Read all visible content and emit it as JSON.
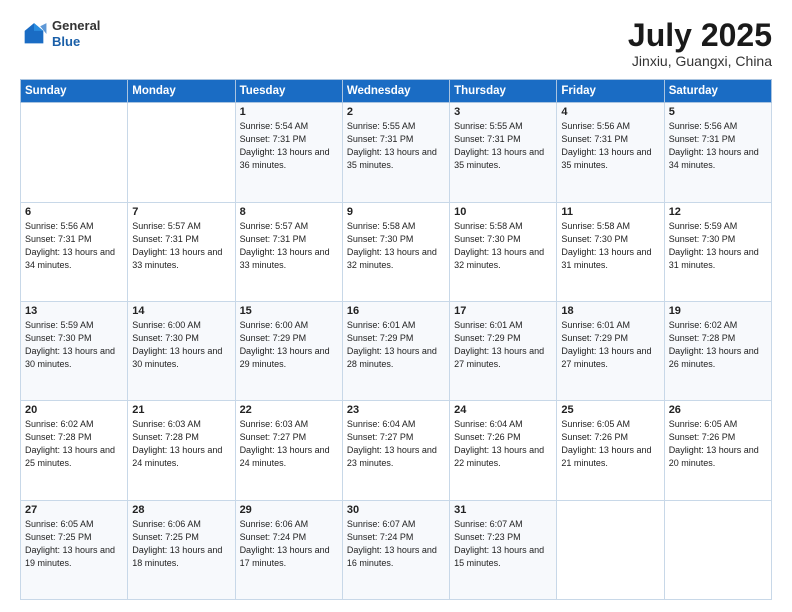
{
  "header": {
    "logo_general": "General",
    "logo_blue": "Blue",
    "month_title": "July 2025",
    "location": "Jinxiu, Guangxi, China"
  },
  "weekdays": [
    "Sunday",
    "Monday",
    "Tuesday",
    "Wednesday",
    "Thursday",
    "Friday",
    "Saturday"
  ],
  "weeks": [
    [
      {
        "day": "",
        "info": ""
      },
      {
        "day": "",
        "info": ""
      },
      {
        "day": "1",
        "info": "Sunrise: 5:54 AM\nSunset: 7:31 PM\nDaylight: 13 hours and 36 minutes."
      },
      {
        "day": "2",
        "info": "Sunrise: 5:55 AM\nSunset: 7:31 PM\nDaylight: 13 hours and 35 minutes."
      },
      {
        "day": "3",
        "info": "Sunrise: 5:55 AM\nSunset: 7:31 PM\nDaylight: 13 hours and 35 minutes."
      },
      {
        "day": "4",
        "info": "Sunrise: 5:56 AM\nSunset: 7:31 PM\nDaylight: 13 hours and 35 minutes."
      },
      {
        "day": "5",
        "info": "Sunrise: 5:56 AM\nSunset: 7:31 PM\nDaylight: 13 hours and 34 minutes."
      }
    ],
    [
      {
        "day": "6",
        "info": "Sunrise: 5:56 AM\nSunset: 7:31 PM\nDaylight: 13 hours and 34 minutes."
      },
      {
        "day": "7",
        "info": "Sunrise: 5:57 AM\nSunset: 7:31 PM\nDaylight: 13 hours and 33 minutes."
      },
      {
        "day": "8",
        "info": "Sunrise: 5:57 AM\nSunset: 7:31 PM\nDaylight: 13 hours and 33 minutes."
      },
      {
        "day": "9",
        "info": "Sunrise: 5:58 AM\nSunset: 7:30 PM\nDaylight: 13 hours and 32 minutes."
      },
      {
        "day": "10",
        "info": "Sunrise: 5:58 AM\nSunset: 7:30 PM\nDaylight: 13 hours and 32 minutes."
      },
      {
        "day": "11",
        "info": "Sunrise: 5:58 AM\nSunset: 7:30 PM\nDaylight: 13 hours and 31 minutes."
      },
      {
        "day": "12",
        "info": "Sunrise: 5:59 AM\nSunset: 7:30 PM\nDaylight: 13 hours and 31 minutes."
      }
    ],
    [
      {
        "day": "13",
        "info": "Sunrise: 5:59 AM\nSunset: 7:30 PM\nDaylight: 13 hours and 30 minutes."
      },
      {
        "day": "14",
        "info": "Sunrise: 6:00 AM\nSunset: 7:30 PM\nDaylight: 13 hours and 30 minutes."
      },
      {
        "day": "15",
        "info": "Sunrise: 6:00 AM\nSunset: 7:29 PM\nDaylight: 13 hours and 29 minutes."
      },
      {
        "day": "16",
        "info": "Sunrise: 6:01 AM\nSunset: 7:29 PM\nDaylight: 13 hours and 28 minutes."
      },
      {
        "day": "17",
        "info": "Sunrise: 6:01 AM\nSunset: 7:29 PM\nDaylight: 13 hours and 27 minutes."
      },
      {
        "day": "18",
        "info": "Sunrise: 6:01 AM\nSunset: 7:29 PM\nDaylight: 13 hours and 27 minutes."
      },
      {
        "day": "19",
        "info": "Sunrise: 6:02 AM\nSunset: 7:28 PM\nDaylight: 13 hours and 26 minutes."
      }
    ],
    [
      {
        "day": "20",
        "info": "Sunrise: 6:02 AM\nSunset: 7:28 PM\nDaylight: 13 hours and 25 minutes."
      },
      {
        "day": "21",
        "info": "Sunrise: 6:03 AM\nSunset: 7:28 PM\nDaylight: 13 hours and 24 minutes."
      },
      {
        "day": "22",
        "info": "Sunrise: 6:03 AM\nSunset: 7:27 PM\nDaylight: 13 hours and 24 minutes."
      },
      {
        "day": "23",
        "info": "Sunrise: 6:04 AM\nSunset: 7:27 PM\nDaylight: 13 hours and 23 minutes."
      },
      {
        "day": "24",
        "info": "Sunrise: 6:04 AM\nSunset: 7:26 PM\nDaylight: 13 hours and 22 minutes."
      },
      {
        "day": "25",
        "info": "Sunrise: 6:05 AM\nSunset: 7:26 PM\nDaylight: 13 hours and 21 minutes."
      },
      {
        "day": "26",
        "info": "Sunrise: 6:05 AM\nSunset: 7:26 PM\nDaylight: 13 hours and 20 minutes."
      }
    ],
    [
      {
        "day": "27",
        "info": "Sunrise: 6:05 AM\nSunset: 7:25 PM\nDaylight: 13 hours and 19 minutes."
      },
      {
        "day": "28",
        "info": "Sunrise: 6:06 AM\nSunset: 7:25 PM\nDaylight: 13 hours and 18 minutes."
      },
      {
        "day": "29",
        "info": "Sunrise: 6:06 AM\nSunset: 7:24 PM\nDaylight: 13 hours and 17 minutes."
      },
      {
        "day": "30",
        "info": "Sunrise: 6:07 AM\nSunset: 7:24 PM\nDaylight: 13 hours and 16 minutes."
      },
      {
        "day": "31",
        "info": "Sunrise: 6:07 AM\nSunset: 7:23 PM\nDaylight: 13 hours and 15 minutes."
      },
      {
        "day": "",
        "info": ""
      },
      {
        "day": "",
        "info": ""
      }
    ]
  ]
}
